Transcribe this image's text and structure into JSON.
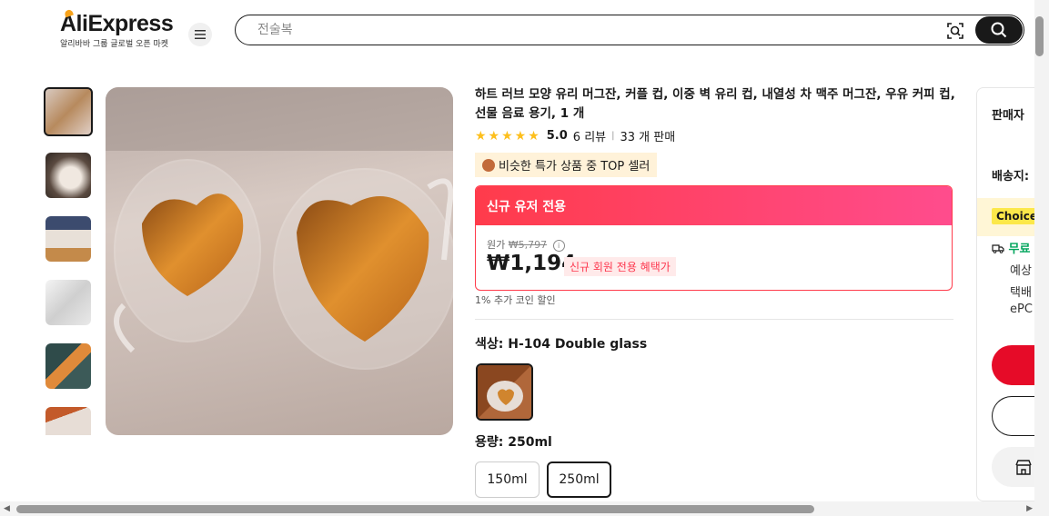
{
  "header": {
    "logo_text": "AliExpress",
    "logo_sub": "알리바바 그룹 글로벌 오픈 마켓",
    "search_placeholder": "전술복"
  },
  "product": {
    "title": "하트 러브 모양 유리 머그잔, 커플 컵, 이중 벽 유리 컵, 내열성 차 맥주 머그잔, 우유 커피 컵, 선물 음료 용기, 1 개",
    "rating": "5.0",
    "reviews": "6 리뷰",
    "sold": "33 개 판매",
    "top_seller": "비슷한 특가 상품 중 TOP 셀러",
    "price_header": "신규 유저 전용",
    "original_label": "원가",
    "original_price": "₩5,797",
    "price": "₩1,194",
    "price_tag": "신규 회원 전용 혜택가",
    "coin_note": "1% 추가 코인 할인",
    "color_label": "색상: H-104 Double glass",
    "size_label": "용량: 250ml",
    "sizes": [
      "150ml",
      "250ml"
    ],
    "selected_size": "250ml"
  },
  "side_panel": {
    "seller": "판매자",
    "ship_to": "배송지:",
    "choice": "Choice",
    "free": "무료",
    "line1": "예상",
    "line2": "택배",
    "line3": "ePC"
  },
  "colors": {
    "accent_red": "#e60b28",
    "price_gradient_start": "#ff3b4b",
    "price_gradient_end": "#ff4c8d",
    "star": "#fdbf1c",
    "free_green": "#00a55c"
  }
}
